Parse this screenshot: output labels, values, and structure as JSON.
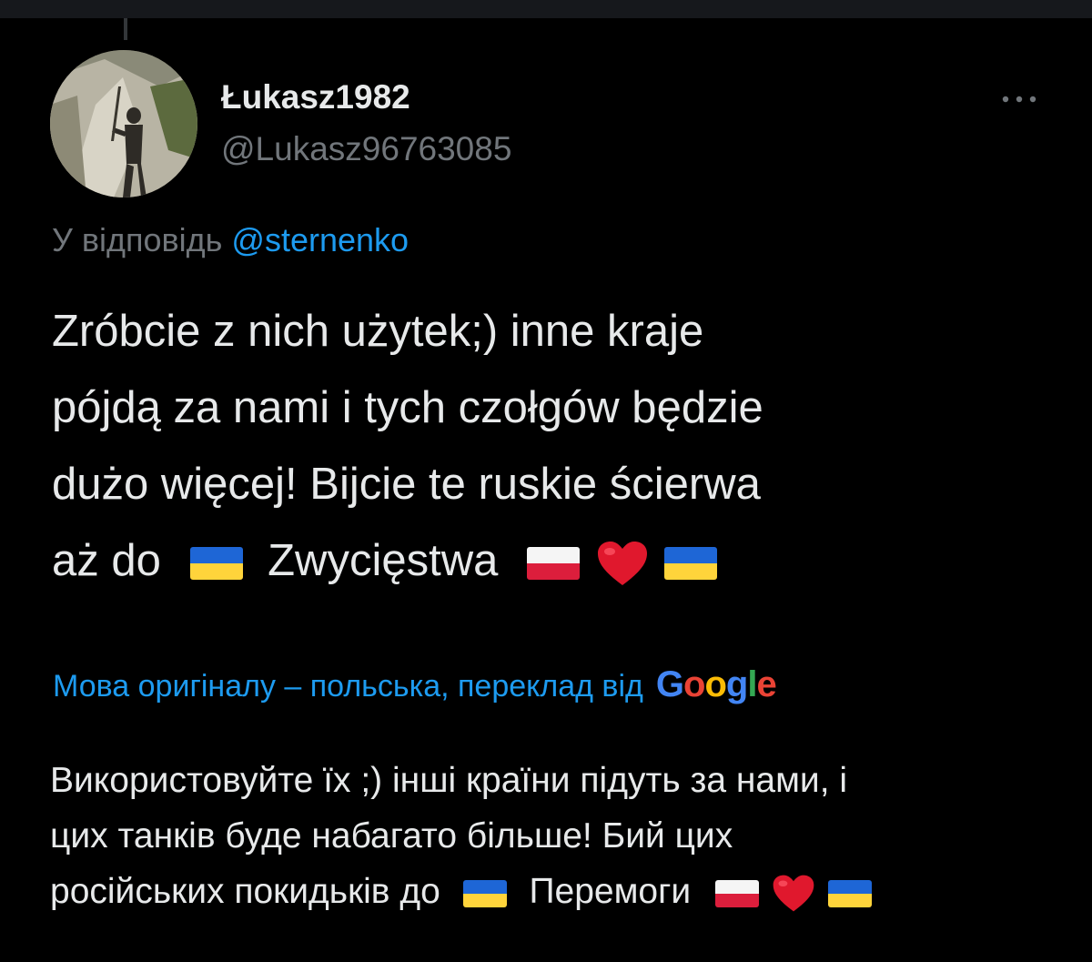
{
  "tweet": {
    "display_name": "Łukasz1982",
    "handle": "@Lukasz96763085",
    "reply_prefix": "У відповідь",
    "reply_mention": "@sternenko",
    "body_lines": [
      "Zróbcie z nich użytek;) inne kraje",
      "pójdą za nami i tych czołgów będzie",
      "dużo więcej! Bijcie te ruskie ścierwa",
      "aż do",
      "Zwycięstwa"
    ],
    "translation_note": "Мова оригіналу – польська, переклад від",
    "translation_provider": "Google",
    "translated_lines": [
      "Використовуйте їх ;) інші країни підуть за нами, і",
      "цих танків буде набагато більше! Бий цих",
      "російських покидьків до",
      "Перемоги"
    ]
  },
  "icons": {
    "more": "more-horizontal-icon",
    "flag_ukraine": "flag-ukraine-icon",
    "flag_poland": "flag-poland-icon",
    "heart": "red-heart-icon"
  },
  "colors": {
    "background": "#000000",
    "text": "#e7e9ea",
    "muted": "#71767b",
    "link": "#1d9bf0",
    "google_blue": "#4285f4",
    "google_red": "#ea4335",
    "google_yellow": "#fbbc05",
    "google_green": "#34a853"
  }
}
